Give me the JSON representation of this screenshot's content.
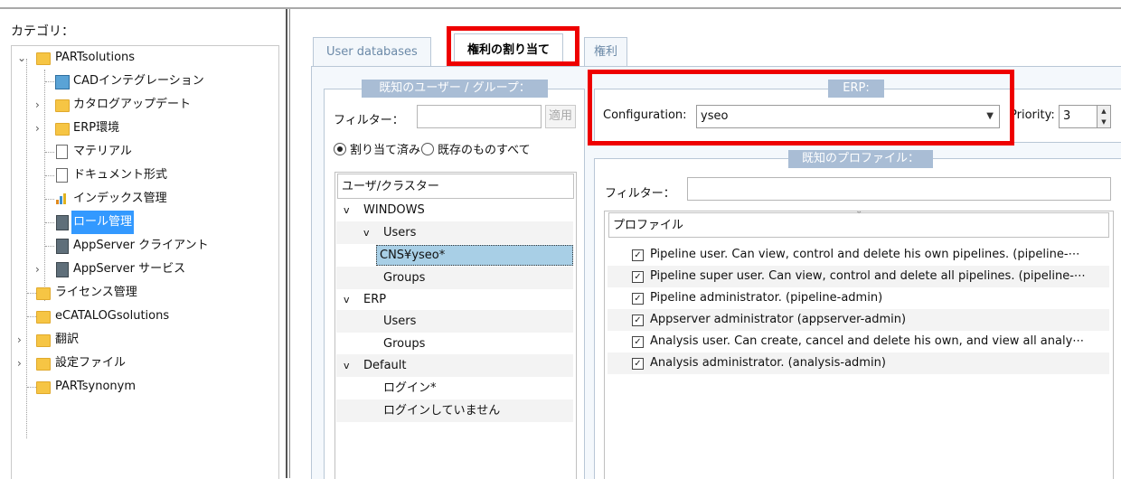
{
  "left_panel": {
    "category_label": "カテゴリ：",
    "tree": [
      {
        "label": "PARTsolutions",
        "icon": "folder-icon",
        "expander": "expanded"
      },
      {
        "label": "CADインテグレーション",
        "icon": "cad-integration-icon"
      },
      {
        "label": "カタログアップデート",
        "icon": "folder-icon",
        "expander": "collapsed"
      },
      {
        "label": "ERP環境",
        "icon": "folder-icon",
        "expander": "collapsed"
      },
      {
        "label": "マテリアル",
        "icon": "document-icon"
      },
      {
        "label": "ドキュメント形式",
        "icon": "document-icon"
      },
      {
        "label": "インデックス管理",
        "icon": "index-icon"
      },
      {
        "label": "ロール管理",
        "icon": "server-icon",
        "selected": true
      },
      {
        "label": "AppServer クライアント",
        "icon": "server-icon"
      },
      {
        "label": "AppServer サービス",
        "icon": "server-icon",
        "expander": "collapsed"
      },
      {
        "label": "ライセンス管理",
        "icon": "folder-icon"
      },
      {
        "label": "eCATALOGsolutions",
        "icon": "folder-icon"
      },
      {
        "label": "翻訳",
        "icon": "folder-icon",
        "expander": "collapsed"
      },
      {
        "label": "設定ファイル",
        "icon": "folder-icon",
        "expander": "collapsed"
      },
      {
        "label": "PARTsynonym",
        "icon": "folder-icon"
      }
    ]
  },
  "tabs": [
    "User databases",
    "権利の割り当て",
    "権利"
  ],
  "active_tab": "権利の割り当て",
  "users_group": {
    "title": "既知のユーザー / グループ：",
    "filter_label": "フィルター：",
    "filter_value": "",
    "apply_button": "適用",
    "radio_assigned": "割り当て済み",
    "radio_all": "既存のものすべて",
    "list_header": "ユーザ/クラスター",
    "tree": {
      "windows": "WINDOWS",
      "windows_users": "Users",
      "windows_user_item": "CNS¥yseo*",
      "windows_groups": "Groups",
      "erp": "ERP",
      "erp_users": "Users",
      "erp_groups": "Groups",
      "default": "Default",
      "default_login": "ログイン*",
      "default_not_logged": "ログインしていません"
    }
  },
  "erp_group": {
    "title": "ERP:",
    "configuration_label": "Configuration:",
    "configuration_value": "yseo",
    "priority_label": "Priority:",
    "priority_value": "3"
  },
  "profiles_group": {
    "title": "既知のプロファイル：",
    "filter_label": "フィルター：",
    "filter_value": "",
    "list_header": "プロファイル",
    "items": [
      {
        "label": "Pipeline user. Can view, control and delete his own pipelines. (pipeline-⋯",
        "checked": true
      },
      {
        "label": "Pipeline super user. Can view, control and delete all pipelines. (pipeline-⋯",
        "checked": true
      },
      {
        "label": "Pipeline administrator. (pipeline-admin)",
        "checked": true
      },
      {
        "label": "Appserver administrator (appserver-admin)",
        "checked": true
      },
      {
        "label": "Analysis user. Can create, cancel and delete his own, and view all analy⋯",
        "checked": true
      },
      {
        "label": "Analysis administrator. (analysis-admin)",
        "checked": true
      }
    ]
  },
  "colors": {
    "highlight_red": "#ee0000",
    "group_title_bg": "#a9bdd5",
    "selection_blue": "#3399ff"
  }
}
